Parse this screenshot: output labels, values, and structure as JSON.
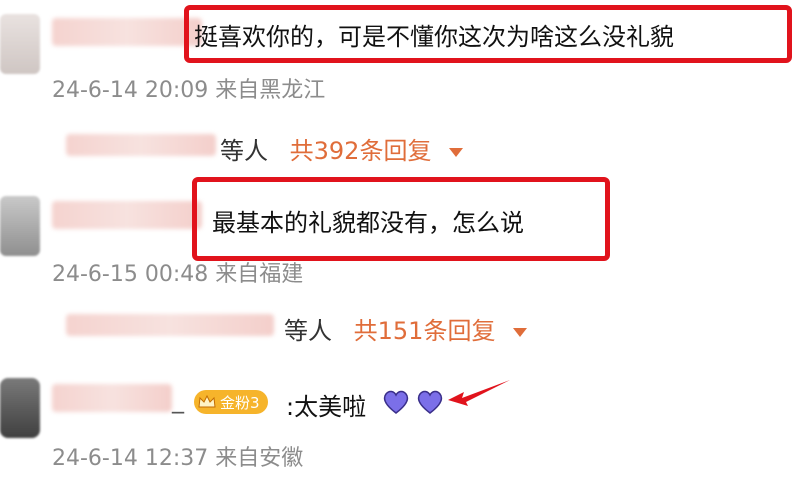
{
  "comments": [
    {
      "text": "挺喜欢你的，可是不懂你这次为啥这么没礼貌",
      "meta": "24-6-14 20:09 来自黑龙江",
      "reply_who": "等人",
      "reply_count": "共392条回复"
    },
    {
      "text": "最基本的礼貌都没有，怎么说",
      "meta": "24-6-15 00:48 来自福建",
      "reply_who": "等人",
      "reply_count": "共151条回复"
    },
    {
      "name_suffix": "_",
      "badge": "金粉3",
      "text": ":太美啦",
      "meta": "24-6-14 12:37 来自安徽"
    }
  ],
  "colors": {
    "highlight_border": "#e1131c",
    "reply_accent": "#e06d3a",
    "heart": "#7b6fe8"
  },
  "icons": [
    "caret-down-icon",
    "crown-icon",
    "purple-heart-icon",
    "red-arrow-icon"
  ]
}
